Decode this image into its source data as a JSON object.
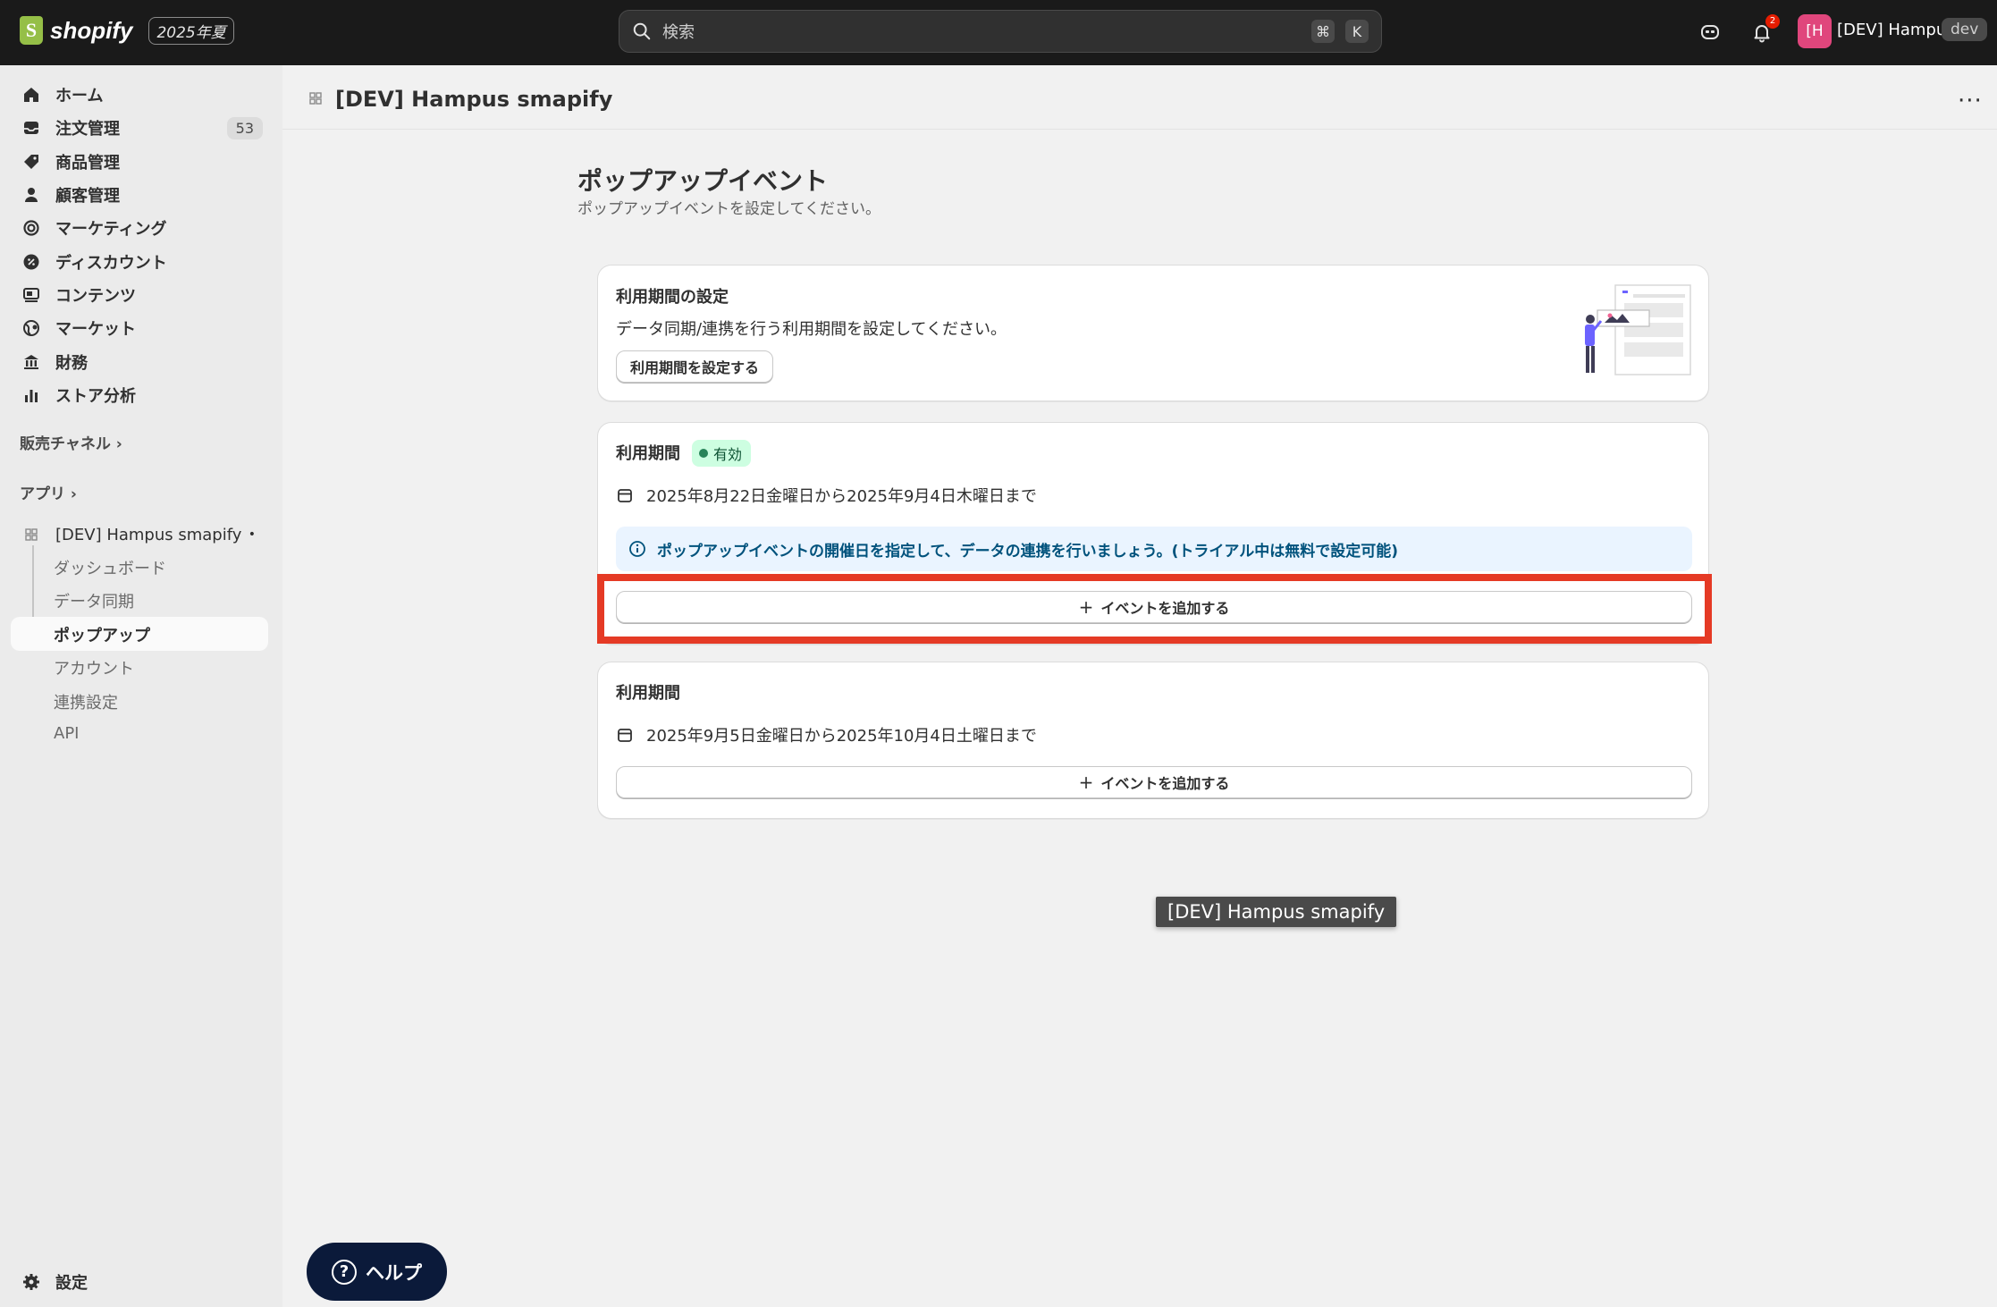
{
  "topbar": {
    "logo_text": "shopify",
    "edition": "2025年夏",
    "search_placeholder": "検索",
    "shortcut_keys": [
      "⌘",
      "K"
    ],
    "notification_count": "2",
    "avatar_initials": "[H",
    "store_name": "[DEV] Hampus",
    "env_badge": "dev"
  },
  "sidebar": {
    "items": [
      {
        "label": "ホーム",
        "icon": "home-icon"
      },
      {
        "label": "注文管理",
        "icon": "inbox-icon",
        "count": "53"
      },
      {
        "label": "商品管理",
        "icon": "tag-icon"
      },
      {
        "label": "顧客管理",
        "icon": "person-icon"
      },
      {
        "label": "マーケティング",
        "icon": "target-icon"
      },
      {
        "label": "ディスカウント",
        "icon": "discount-icon"
      },
      {
        "label": "コンテンツ",
        "icon": "content-icon"
      },
      {
        "label": "マーケット",
        "icon": "globe-icon"
      },
      {
        "label": "財務",
        "icon": "bank-icon"
      },
      {
        "label": "ストア分析",
        "icon": "chart-icon"
      }
    ],
    "sales_channels_label": "販売チャネル",
    "apps_label": "アプリ",
    "app_name": "[DEV] Hampus smapify",
    "app_sub_items": [
      "ダッシュボード",
      "データ同期",
      "ポップアップ",
      "アカウント",
      "連携設定",
      "API"
    ],
    "active_sub_item": "ポップアップ",
    "settings_label": "設定"
  },
  "header": {
    "app_title": "[DEV] Hampus smapify",
    "more_label": "···"
  },
  "page": {
    "title": "ポップアップイベント",
    "subtitle": "ポップアップイベントを設定してください。"
  },
  "period_settings_card": {
    "title": "利用期間の設定",
    "description": "データ同期/連携を行う利用期間を設定してください。",
    "button_label": "利用期間を設定する"
  },
  "period_card_1": {
    "title": "利用期間",
    "status": "有効",
    "date_range": "2025年8月22日金曜日から2025年9月4日木曜日まで",
    "info_text": "ポップアップイベントの開催日を指定して、データの連携を行いましょう。(トライアル中は無料で設定可能)",
    "add_button_label": "イベントを追加する"
  },
  "period_card_2": {
    "title": "利用期間",
    "date_range": "2025年9月5日金曜日から2025年10月4日土曜日まで",
    "add_button_label": "イベントを追加する"
  },
  "tooltip": {
    "text": "[DEV] Hampus smapify"
  },
  "help_button": {
    "label": "ヘルプ"
  },
  "colors": {
    "topbar_bg": "#1a1a1a",
    "highlight": "#e53a25",
    "status_bg": "#cdfee1",
    "info_bg": "#eaf4ff",
    "help_bg": "#0b1a3a"
  }
}
